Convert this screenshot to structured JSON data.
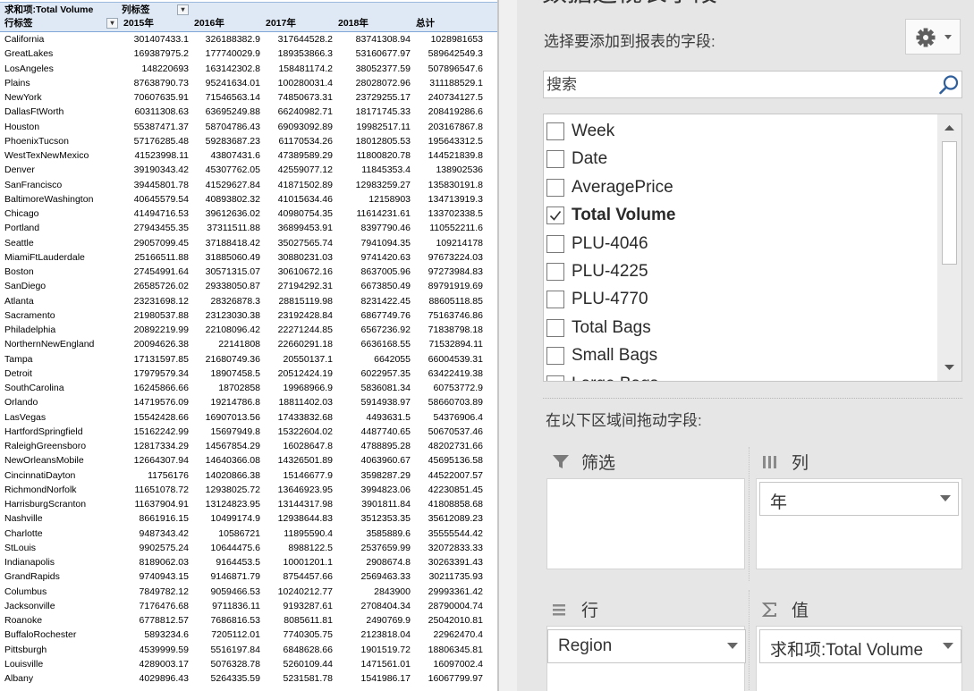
{
  "pivot": {
    "value_caption": "求和项:Total Volume",
    "col_caption": "列标签",
    "row_caption": "行标签",
    "years": [
      "2015年",
      "2016年",
      "2017年",
      "2018年",
      "总计"
    ],
    "rows": [
      {
        "region": "California",
        "values": [
          "301407433.1",
          "326188382.9",
          "317644528.2",
          "83741308.94",
          "1028981653"
        ]
      },
      {
        "region": "GreatLakes",
        "values": [
          "169387975.2",
          "177740029.9",
          "189353866.3",
          "53160677.97",
          "589642549.3"
        ]
      },
      {
        "region": "LosAngeles",
        "values": [
          "148220693",
          "163142302.8",
          "158481174.2",
          "38052377.59",
          "507896547.6"
        ]
      },
      {
        "region": "Plains",
        "values": [
          "87638790.73",
          "95241634.01",
          "100280031.4",
          "28028072.96",
          "311188529.1"
        ]
      },
      {
        "region": "NewYork",
        "values": [
          "70607635.91",
          "71546563.14",
          "74850673.31",
          "23729255.17",
          "240734127.5"
        ]
      },
      {
        "region": "DallasFtWorth",
        "values": [
          "60311308.63",
          "63695249.88",
          "66240982.71",
          "18171745.33",
          "208419286.6"
        ]
      },
      {
        "region": "Houston",
        "values": [
          "55387471.37",
          "58704786.43",
          "69093092.89",
          "19982517.11",
          "203167867.8"
        ]
      },
      {
        "region": "PhoenixTucson",
        "values": [
          "57176285.48",
          "59283687.23",
          "61170534.26",
          "18012805.53",
          "195643312.5"
        ]
      },
      {
        "region": "WestTexNewMexico",
        "values": [
          "41523998.11",
          "43807431.6",
          "47389589.29",
          "11800820.78",
          "144521839.8"
        ]
      },
      {
        "region": "Denver",
        "values": [
          "39190343.42",
          "45307762.05",
          "42559077.12",
          "11845353.4",
          "138902536"
        ]
      },
      {
        "region": "SanFrancisco",
        "values": [
          "39445801.78",
          "41529627.84",
          "41871502.89",
          "12983259.27",
          "135830191.8"
        ]
      },
      {
        "region": "BaltimoreWashington",
        "values": [
          "40645579.54",
          "40893802.32",
          "41015634.46",
          "12158903",
          "134713919.3"
        ]
      },
      {
        "region": "Chicago",
        "values": [
          "41494716.53",
          "39612636.02",
          "40980754.35",
          "11614231.61",
          "133702338.5"
        ]
      },
      {
        "region": "Portland",
        "values": [
          "27943455.35",
          "37311511.88",
          "36899453.91",
          "8397790.46",
          "110552211.6"
        ]
      },
      {
        "region": "Seattle",
        "values": [
          "29057099.45",
          "37188418.42",
          "35027565.74",
          "7941094.35",
          "109214178"
        ]
      },
      {
        "region": "MiamiFtLauderdale",
        "values": [
          "25166511.88",
          "31885060.49",
          "30880231.03",
          "9741420.63",
          "97673224.03"
        ]
      },
      {
        "region": "Boston",
        "values": [
          "27454991.64",
          "30571315.07",
          "30610672.16",
          "8637005.96",
          "97273984.83"
        ]
      },
      {
        "region": "SanDiego",
        "values": [
          "26585726.02",
          "29338050.87",
          "27194292.31",
          "6673850.49",
          "89791919.69"
        ]
      },
      {
        "region": "Atlanta",
        "values": [
          "23231698.12",
          "28326878.3",
          "28815119.98",
          "8231422.45",
          "88605118.85"
        ]
      },
      {
        "region": "Sacramento",
        "values": [
          "21980537.88",
          "23123030.38",
          "23192428.84",
          "6867749.76",
          "75163746.86"
        ]
      },
      {
        "region": "Philadelphia",
        "values": [
          "20892219.99",
          "22108096.42",
          "22271244.85",
          "6567236.92",
          "71838798.18"
        ]
      },
      {
        "region": "NorthernNewEngland",
        "values": [
          "20094626.38",
          "22141808",
          "22660291.18",
          "6636168.55",
          "71532894.11"
        ]
      },
      {
        "region": "Tampa",
        "values": [
          "17131597.85",
          "21680749.36",
          "20550137.1",
          "6642055",
          "66004539.31"
        ]
      },
      {
        "region": "Detroit",
        "values": [
          "17979579.34",
          "18907458.5",
          "20512424.19",
          "6022957.35",
          "63422419.38"
        ]
      },
      {
        "region": "SouthCarolina",
        "values": [
          "16245866.66",
          "18702858",
          "19968966.9",
          "5836081.34",
          "60753772.9"
        ]
      },
      {
        "region": "Orlando",
        "values": [
          "14719576.09",
          "19214786.8",
          "18811402.03",
          "5914938.97",
          "58660703.89"
        ]
      },
      {
        "region": "LasVegas",
        "values": [
          "15542428.66",
          "16907013.56",
          "17433832.68",
          "4493631.5",
          "54376906.4"
        ]
      },
      {
        "region": "HartfordSpringfield",
        "values": [
          "15162242.99",
          "15697949.8",
          "15322604.02",
          "4487740.65",
          "50670537.46"
        ]
      },
      {
        "region": "RaleighGreensboro",
        "values": [
          "12817334.29",
          "14567854.29",
          "16028647.8",
          "4788895.28",
          "48202731.66"
        ]
      },
      {
        "region": "NewOrleansMobile",
        "values": [
          "12664307.94",
          "14640366.08",
          "14326501.89",
          "4063960.67",
          "45695136.58"
        ]
      },
      {
        "region": "CincinnatiDayton",
        "values": [
          "11756176",
          "14020866.38",
          "15146677.9",
          "3598287.29",
          "44522007.57"
        ]
      },
      {
        "region": "RichmondNorfolk",
        "values": [
          "11651078.72",
          "12938025.72",
          "13646923.95",
          "3994823.06",
          "42230851.45"
        ]
      },
      {
        "region": "HarrisburgScranton",
        "values": [
          "11637904.91",
          "13124823.95",
          "13144317.98",
          "3901811.84",
          "41808858.68"
        ]
      },
      {
        "region": "Nashville",
        "values": [
          "8661916.15",
          "10499174.9",
          "12938644.83",
          "3512353.35",
          "35612089.23"
        ]
      },
      {
        "region": "Charlotte",
        "values": [
          "9487343.42",
          "10586721",
          "11895590.4",
          "3585889.6",
          "35555544.42"
        ]
      },
      {
        "region": "StLouis",
        "values": [
          "9902575.24",
          "10644475.6",
          "8988122.5",
          "2537659.99",
          "32072833.33"
        ]
      },
      {
        "region": "Indianapolis",
        "values": [
          "8189062.03",
          "9164453.5",
          "10001201.1",
          "2908674.8",
          "30263391.43"
        ]
      },
      {
        "region": "GrandRapids",
        "values": [
          "9740943.15",
          "9146871.79",
          "8754457.66",
          "2569463.33",
          "30211735.93"
        ]
      },
      {
        "region": "Columbus",
        "values": [
          "7849782.12",
          "9059466.53",
          "10240212.77",
          "2843900",
          "29993361.42"
        ]
      },
      {
        "region": "Jacksonville",
        "values": [
          "7176476.68",
          "9711836.11",
          "9193287.61",
          "2708404.34",
          "28790004.74"
        ]
      },
      {
        "region": "Roanoke",
        "values": [
          "6778812.57",
          "7686816.53",
          "8085611.81",
          "2490769.9",
          "25042010.81"
        ]
      },
      {
        "region": "BuffaloRochester",
        "values": [
          "5893234.6",
          "7205112.01",
          "7740305.75",
          "2123818.04",
          "22962470.4"
        ]
      },
      {
        "region": "Pittsburgh",
        "values": [
          "4539999.59",
          "5516197.84",
          "6848628.66",
          "1901519.72",
          "18806345.81"
        ]
      },
      {
        "region": "Louisville",
        "values": [
          "4289003.17",
          "5076328.78",
          "5260109.44",
          "1471561.01",
          "16097002.4"
        ]
      },
      {
        "region": "Albany",
        "values": [
          "4029896.43",
          "5264335.59",
          "5231581.78",
          "1541986.17",
          "16067799.97"
        ]
      }
    ]
  },
  "pane": {
    "title": "数据透视表字段",
    "choose_label": "选择要添加到报表的字段:",
    "search_placeholder": "搜索",
    "fields": [
      {
        "label": "Week",
        "checked": false
      },
      {
        "label": "Date",
        "checked": false
      },
      {
        "label": "AveragePrice",
        "checked": false
      },
      {
        "label": "Total Volume",
        "checked": true
      },
      {
        "label": "PLU-4046",
        "checked": false
      },
      {
        "label": "PLU-4225",
        "checked": false
      },
      {
        "label": "PLU-4770",
        "checked": false
      },
      {
        "label": "Total Bags",
        "checked": false
      },
      {
        "label": "Small Bags",
        "checked": false
      },
      {
        "label": "Large Bags",
        "checked": false
      }
    ],
    "drag_label": "在以下区域间拖动字段:",
    "zones": {
      "filter": {
        "label": "筛选"
      },
      "columns": {
        "label": "列",
        "item": "年"
      },
      "rows": {
        "label": "行",
        "item": "Region"
      },
      "values": {
        "label": "值",
        "item": "求和项:Total Volume"
      }
    }
  }
}
